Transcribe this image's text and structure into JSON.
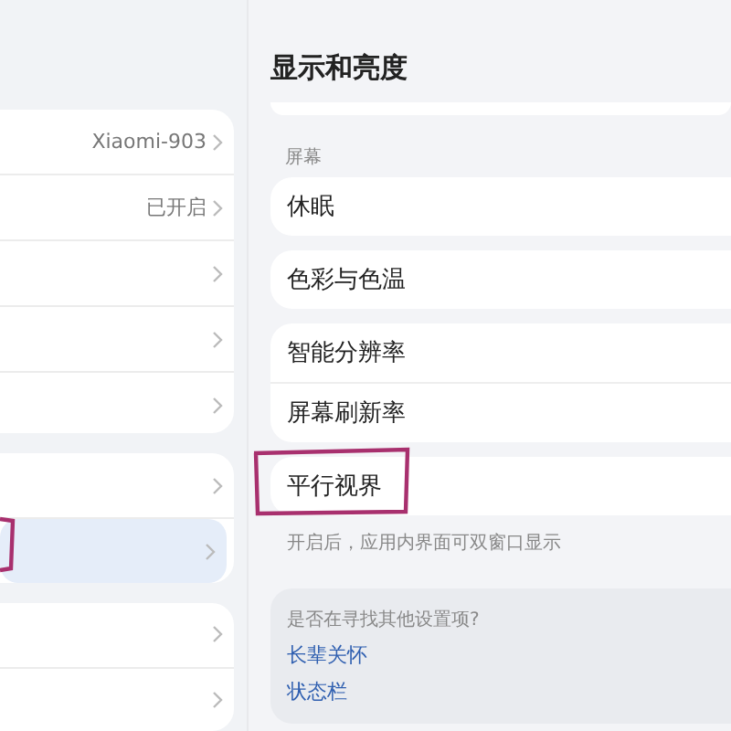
{
  "left_panel": {
    "groups": [
      {
        "rows": [
          {
            "value": "Xiaomi-903",
            "selected": false
          },
          {
            "value": "已开启",
            "selected": false
          },
          {
            "selected": false
          },
          {
            "selected": false
          },
          {
            "selected": false
          }
        ]
      },
      {
        "rows": [
          {
            "selected": false
          },
          {
            "selected": true
          }
        ]
      },
      {
        "rows": [
          {
            "selected": false
          },
          {
            "selected": false
          }
        ]
      }
    ]
  },
  "detail": {
    "title": "显示和亮度",
    "section_label": "屏幕",
    "cards": [
      {
        "rows": [
          "休眠"
        ]
      },
      {
        "rows": [
          "色彩与色温"
        ]
      },
      {
        "rows": [
          "智能分辨率",
          "屏幕刷新率"
        ]
      },
      {
        "rows": [
          "平行视界"
        ]
      }
    ],
    "description": "开启后，应用内界面可双窗口显示",
    "suggestions": {
      "question": "是否在寻找其他设置项?",
      "links": [
        "长辈关怀",
        "状态栏"
      ]
    }
  }
}
